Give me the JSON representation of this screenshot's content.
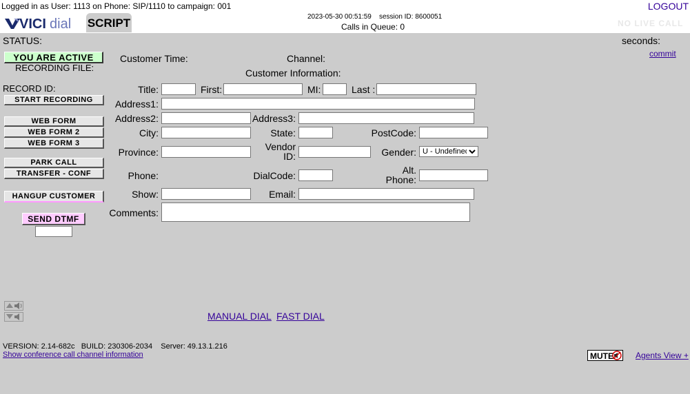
{
  "header": {
    "login_text": "Logged in as User: 1113 on Phone: SIP/1110  to campaign: 001",
    "logout": "LOGOUT",
    "logo_text": "VICIdial",
    "script_tab": "SCRIPT",
    "datetime": "2023-05-30 00:51:59    session ID: 8600051",
    "calls_in_queue": "Calls in Queue: 0",
    "live_call_status": "NO LIVE CALL"
  },
  "status": {
    "status_label": "STATUS:",
    "seconds_label": "seconds:",
    "commit_link": "commit",
    "active_button": "YOU ARE ACTIVE",
    "recording_file_label": "RECORDING FILE:",
    "record_id_label": "RECORD ID:"
  },
  "buttons": {
    "start_recording": "START RECORDING",
    "web_form": "WEB FORM",
    "web_form_2": "WEB FORM 2",
    "web_form_3": "WEB FORM 3",
    "park_call": "PARK CALL",
    "transfer_conf": "TRANSFER - CONF",
    "hangup_customer": "HANGUP CUSTOMER",
    "send_dtmf": "SEND DTMF"
  },
  "customer": {
    "customer_time_label": "Customer Time:",
    "channel_label": "Channel:",
    "info_heading": "Customer Information:",
    "title_label": "Title:",
    "first_label": "First:",
    "mi_label": "MI:",
    "last_label": "Last :",
    "address1_label": "Address1:",
    "address2_label": "Address2:",
    "address3_label": "Address3:",
    "city_label": "City:",
    "state_label": "State:",
    "postcode_label": "PostCode:",
    "province_label": "Province:",
    "vendor_id_label_1": "Vendor",
    "vendor_id_label_2": "ID:",
    "gender_label": "Gender:",
    "gender_value": "U - Undefined",
    "phone_label": "Phone:",
    "dialcode_label": "DialCode:",
    "alt_phone_label_1": "Alt.",
    "alt_phone_label_2": "Phone:",
    "show_label": "Show:",
    "email_label": "Email:",
    "comments_label": "Comments:"
  },
  "dial": {
    "manual_dial": "MANUAL DIAL",
    "fast_dial": "FAST DIAL"
  },
  "footer": {
    "version": "VERSION: 2.14-682c   BUILD: 230306-2034    Server: 49.13.1.216",
    "conf_info_link": "Show conference call channel information",
    "mute": "MUTE",
    "agents_view": "Agents View +"
  },
  "colors": {
    "background": "#cccccc",
    "active_green": "#ccffcc",
    "dtmf_pink": "#ffccff",
    "link_purple": "#330099"
  }
}
